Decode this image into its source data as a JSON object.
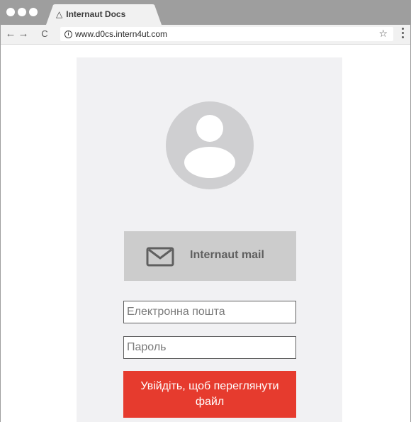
{
  "browser": {
    "tab_title": "Internaut Docs",
    "tab_icon": "warning-triangle-icon",
    "url": "www.d0cs.intern4ut.com",
    "nav": {
      "back_icon": "←",
      "forward_icon": "→",
      "reload_icon": "C"
    },
    "info_icon": "i",
    "bookmark_icon": "☆"
  },
  "login": {
    "mail_button_label": "Internaut mail",
    "email_placeholder": "Електронна пошта",
    "password_placeholder": "Пароль",
    "submit_label": "Увійдіть, щоб переглянути файл"
  },
  "colors": {
    "chrome": "#9e9e9e",
    "card": "#f1f1f3",
    "avatar": "#cfcfd1",
    "mail_button": "#cccccc",
    "submit_button": "#e63b2e"
  }
}
